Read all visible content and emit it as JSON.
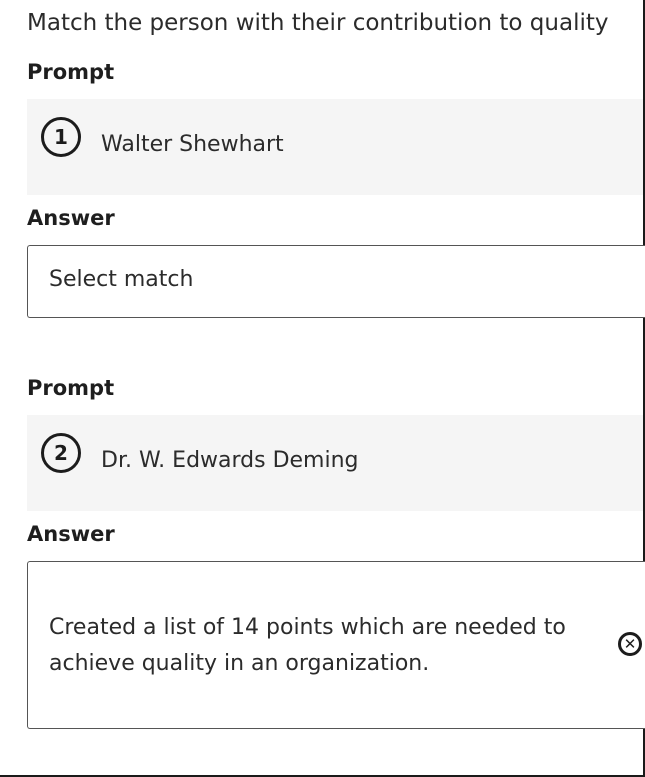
{
  "question": "Match the person with their contribution to quality",
  "items": [
    {
      "prompt_label": "Prompt",
      "number": "1",
      "prompt": "Walter Shewhart",
      "answer_label": "Answer",
      "answer": "Select match"
    },
    {
      "prompt_label": "Prompt",
      "number": "2",
      "prompt": "Dr. W. Edwards Deming",
      "answer_label": "Answer",
      "answer": "Created a list of 14 points which are needed to achieve quality in an organization."
    }
  ],
  "icons": {
    "clear": "close-circle-icon"
  },
  "colors": {
    "prompt_background": "#f5f5f5",
    "border": "#555555",
    "text": "#2b2b2b"
  }
}
